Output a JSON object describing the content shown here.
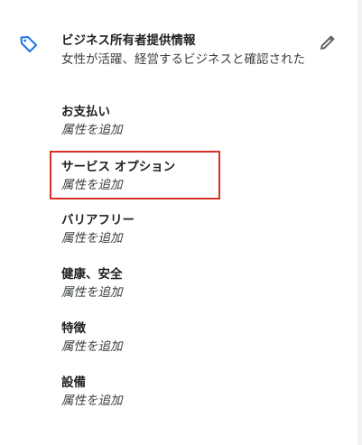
{
  "owner_info": {
    "heading": "ビジネス所有者提供情報",
    "description": "女性が活躍、経営するビジネスと確認された"
  },
  "sections": [
    {
      "heading": "お支払い",
      "action": "属性を追加"
    },
    {
      "heading": "サービス オプション",
      "action": "属性を追加"
    },
    {
      "heading": "バリアフリー",
      "action": "属性を追加"
    },
    {
      "heading": "健康、安全",
      "action": "属性を追加"
    },
    {
      "heading": "特徴",
      "action": "属性を追加"
    },
    {
      "heading": "設備",
      "action": "属性を追加"
    }
  ],
  "icons": {
    "tag": "tag-icon",
    "edit": "pencil-icon"
  },
  "colors": {
    "accent": "#1a73e8",
    "highlight_border": "#d93025",
    "heading_text": "#202124",
    "body_text": "#3c4043"
  }
}
